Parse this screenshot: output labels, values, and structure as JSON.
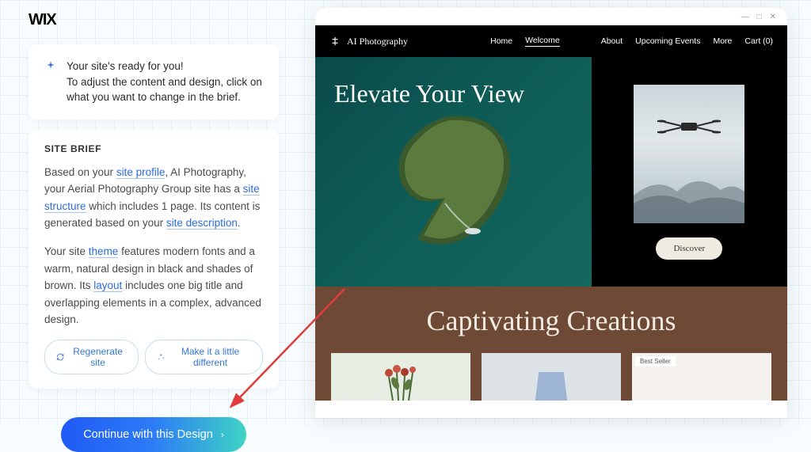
{
  "logo": "WIX",
  "ready_message": "Your site's ready for you!\nTo adjust the content and design, click on what you want to change in the brief.",
  "brief": {
    "title": "SITE BRIEF",
    "p1_a": "Based on your ",
    "link_profile": "site profile",
    "p1_b": ", AI Photography, your Aerial Photography Group site has a ",
    "link_structure": "site structure",
    "p1_c": " which includes 1 page. Its content is generated based on your ",
    "link_description": "site description",
    "p1_d": ".",
    "p2_a": "Your site ",
    "link_theme": "theme",
    "p2_b": " features modern fonts and a warm, natural design in black and shades of brown. Its ",
    "link_layout": "layout",
    "p2_c": " includes one big title and overlapping elements in a complex, advanced design."
  },
  "buttons": {
    "regenerate": "Regenerate site",
    "different": "Make it a little different",
    "continue": "Continue with this Design"
  },
  "preview": {
    "brand": "AI Photography",
    "nav": {
      "home": "Home",
      "welcome": "Welcome",
      "about": "About",
      "events": "Upcoming Events",
      "more": "More",
      "cart": "Cart (0)"
    },
    "hero_title": "Elevate Your View",
    "discover": "Discover",
    "creations_title": "Captivating Creations",
    "badge": "Best Seller"
  }
}
